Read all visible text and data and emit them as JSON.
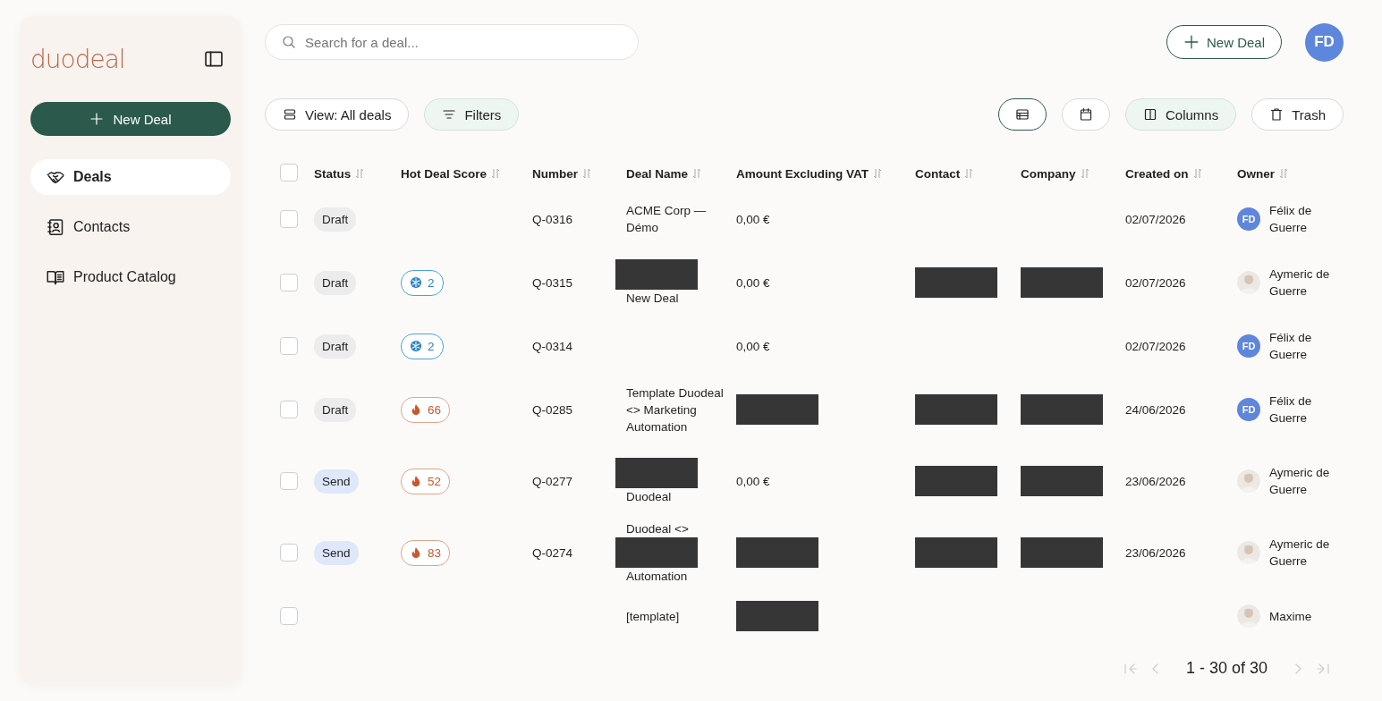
{
  "sidebar": {
    "logo": "duodeal",
    "new_deal": "New Deal",
    "items": [
      {
        "label": "Deals",
        "selected": true
      },
      {
        "label": "Contacts",
        "selected": false
      },
      {
        "label": "Product Catalog",
        "selected": false
      }
    ]
  },
  "search": {
    "placeholder": "Search for a deal..."
  },
  "header": {
    "new_deal": "New Deal",
    "avatar": "FD"
  },
  "toolbar": {
    "view": "View: All deals",
    "filters": {
      "label": "Filters",
      "active": true
    },
    "view_modes": [
      {
        "kind": "table",
        "selected": true
      },
      {
        "kind": "calendar",
        "selected": false
      }
    ],
    "columns": {
      "label": "Columns",
      "active": true
    },
    "trash": "Trash"
  },
  "table": {
    "all_checked": false,
    "columns": [
      "Status",
      "Hot Deal Score",
      "Number",
      "Deal Name",
      "Amount Excluding VAT",
      "Contact",
      "Company",
      "Created on",
      "Owner"
    ],
    "rows": [
      {
        "checked": false,
        "status": {
          "label": "Draft",
          "kind": "draft"
        },
        "number": "Q-0316",
        "deal_name": [
          {
            "kind": "text",
            "text": "ACME Corp — Démo"
          }
        ],
        "amount": [
          {
            "kind": "text",
            "text": "0,00 €"
          }
        ],
        "created": "02/07/2026",
        "owner": {
          "name": "Félix de Guerre",
          "kind": "initials",
          "initials": "FD"
        }
      },
      {
        "checked": false,
        "status": {
          "label": "Draft",
          "kind": "draft"
        },
        "score": {
          "value": "2",
          "kind": "cold"
        },
        "number": "Q-0315",
        "deal_name": [
          {
            "kind": "redaction"
          },
          {
            "kind": "text",
            "text": "New Deal"
          }
        ],
        "amount": [
          {
            "kind": "text",
            "text": "0,00 €"
          }
        ],
        "contact": [
          {
            "kind": "redaction"
          }
        ],
        "company": [
          {
            "kind": "redaction"
          }
        ],
        "created": "02/07/2026",
        "owner": {
          "name": "Aymeric de Guerre"
        }
      },
      {
        "checked": false,
        "status": {
          "label": "Draft",
          "kind": "draft"
        },
        "score": {
          "value": "2",
          "kind": "cold"
        },
        "number": "Q-0314",
        "amount": [
          {
            "kind": "text",
            "text": "0,00 €"
          }
        ],
        "created": "02/07/2026",
        "owner": {
          "name": "Félix de Guerre",
          "kind": "initials",
          "initials": "FD"
        }
      },
      {
        "checked": false,
        "status": {
          "label": "Draft",
          "kind": "draft"
        },
        "score": {
          "value": "66",
          "kind": "hot"
        },
        "number": "Q-0285",
        "deal_name": [
          {
            "kind": "text",
            "text": "Template Duodeal <> Marketing Automation"
          }
        ],
        "amount": [
          {
            "kind": "redaction"
          }
        ],
        "contact": [
          {
            "kind": "redaction"
          }
        ],
        "company": [
          {
            "kind": "redaction"
          }
        ],
        "created": "24/06/2026",
        "owner": {
          "name": "Félix de Guerre",
          "kind": "initials",
          "initials": "FD"
        }
      },
      {
        "checked": false,
        "status": {
          "label": "Send",
          "kind": "send"
        },
        "score": {
          "value": "52",
          "kind": "hot"
        },
        "number": "Q-0277",
        "deal_name": [
          {
            "kind": "redaction"
          },
          {
            "kind": "text",
            "text": "Duodeal"
          }
        ],
        "amount": [
          {
            "kind": "text",
            "text": "0,00 €"
          }
        ],
        "contact": [
          {
            "kind": "redaction"
          }
        ],
        "company": [
          {
            "kind": "redaction"
          }
        ],
        "created": "23/06/2026",
        "owner": {
          "name": "Aymeric de Guerre"
        }
      },
      {
        "checked": false,
        "status": {
          "label": "Send",
          "kind": "send"
        },
        "score": {
          "value": "83",
          "kind": "hot"
        },
        "number": "Q-0274",
        "deal_name": [
          {
            "kind": "text",
            "text": "Duodeal <>"
          },
          {
            "kind": "redaction"
          },
          {
            "kind": "text",
            "text": "Automation"
          }
        ],
        "amount": [
          {
            "kind": "redaction"
          }
        ],
        "contact": [
          {
            "kind": "redaction"
          }
        ],
        "company": [
          {
            "kind": "redaction"
          }
        ],
        "created": "23/06/2026",
        "owner": {
          "name": "Aymeric de Guerre"
        }
      },
      {
        "checked": false,
        "deal_name": [
          {
            "kind": "text",
            "text": "[template]"
          }
        ],
        "amount": [
          {
            "kind": "redaction"
          }
        ],
        "owner": {
          "name": "Maxime"
        }
      }
    ]
  },
  "pagination": {
    "label": "1 - 30 of 30"
  }
}
